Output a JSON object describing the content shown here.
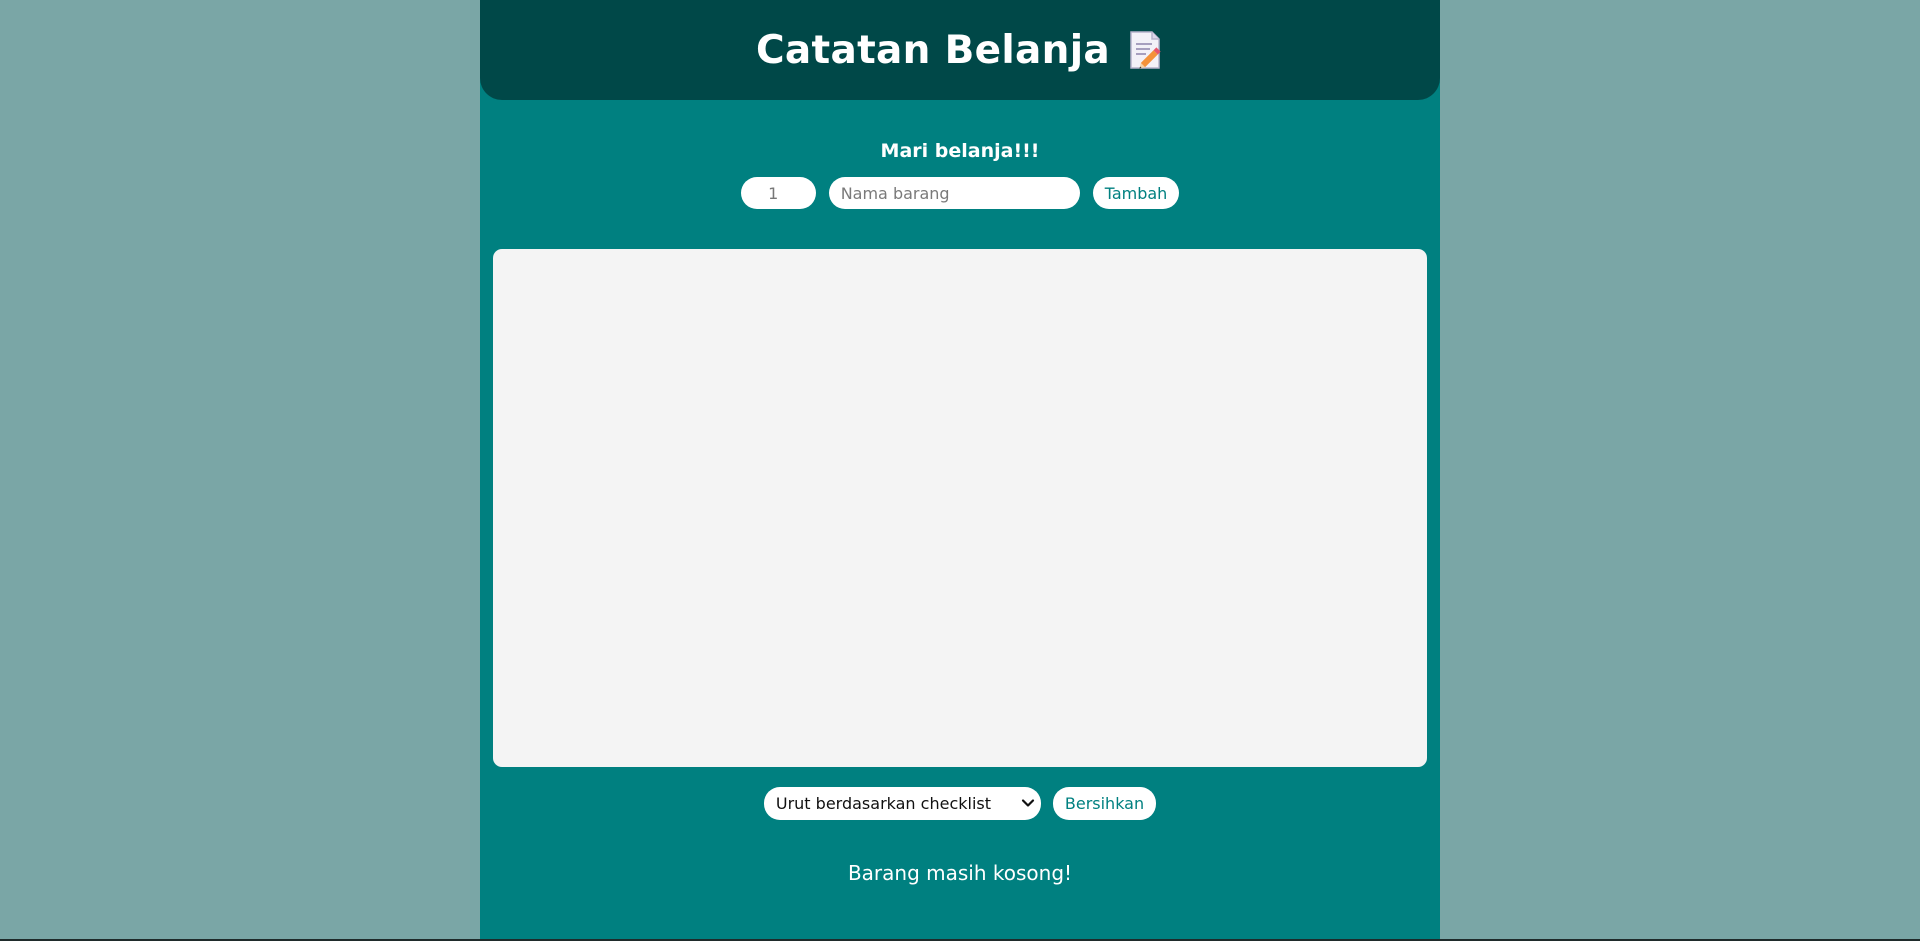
{
  "header": {
    "title": "Catatan Belanja",
    "icon": "memo-icon"
  },
  "form": {
    "subtitle": "Mari belanja!!!",
    "quantity_value": "1",
    "name_placeholder": "Nama barang",
    "add_button_label": "Tambah"
  },
  "list": {
    "items": []
  },
  "actions": {
    "sort_selected": "Urut berdasarkan checklist",
    "clear_button_label": "Bersihkan"
  },
  "status": {
    "message": "Barang masih kosong!"
  },
  "colors": {
    "background": "#7aa6a6",
    "app": "#008080",
    "header": "#004848",
    "list_area": "#f4f4f4",
    "button_text": "#008080"
  }
}
